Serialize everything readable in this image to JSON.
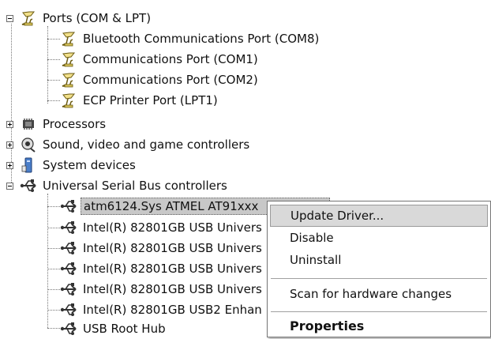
{
  "tree": {
    "ports": {
      "label": "Ports (COM & LPT)",
      "children": [
        "Bluetooth Communications Port (COM8)",
        "Communications Port (COM1)",
        "Communications Port (COM2)",
        "ECP Printer Port (LPT1)"
      ]
    },
    "processors": "Processors",
    "sound": "Sound, video and game controllers",
    "system": "System devices",
    "usb": {
      "label": "Universal Serial Bus controllers",
      "children": [
        "atm6124.Sys ATMEL AT91xxx",
        "Intel(R) 82801GB USB Univers",
        "Intel(R) 82801GB USB Univers",
        "Intel(R) 82801GB USB Univers",
        "Intel(R) 82801GB USB Univers",
        "Intel(R) 82801GB USB2 Enhan",
        "USB Root Hub"
      ]
    }
  },
  "context_menu": {
    "update_driver": "Update Driver...",
    "disable": "Disable",
    "uninstall": "Uninstall",
    "scan": "Scan for hardware changes",
    "properties": "Properties"
  }
}
